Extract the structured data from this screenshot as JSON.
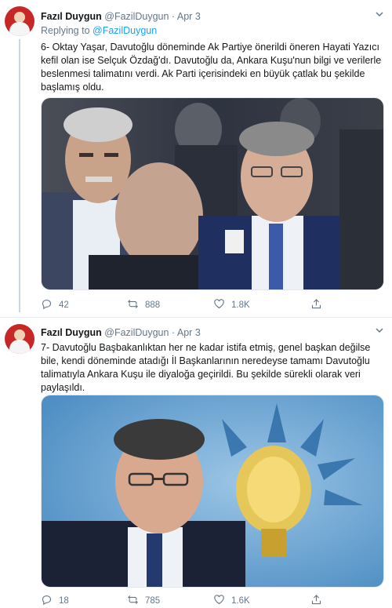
{
  "tweets": [
    {
      "author_name": "Fazıl Duygun",
      "handle": "@FazilDuygun",
      "date": "Apr 3",
      "separator": "·",
      "replying_prefix": "Replying to",
      "replying_to": "@FazilDuygun",
      "text": "6- Oktay Yaşar, Davutoğlu döneminde Ak Partiye önerildi öneren Hayati Yazıcı kefil olan ise Selçuk Özdağ'dı. Davutoğlu da, Ankara Kuşu'nun bilgi ve verilerle beslenmesi talimatını verdi. Ak Parti içerisindeki en büyük çatlak bu şekilde başlamış oldu.",
      "replies": "42",
      "retweets": "888",
      "likes": "1.8K"
    },
    {
      "author_name": "Fazıl Duygun",
      "handle": "@FazilDuygun",
      "date": "Apr 3",
      "separator": "·",
      "text": "7- Davutoğlu Başbakanlıktan her ne kadar istifa etmiş, genel başkan değilse bile, kendi döneminde atadığı İl Başkanlarının neredeyse tamamı Davutoğlu talimatıyla Ankara Kuşu ile diyaloğa geçirildi. Bu şekilde sürekli olarak veri paylaşıldı.",
      "replies": "18",
      "retweets": "785",
      "likes": "1.6K"
    }
  ],
  "icons": {
    "more": "chevron-down-icon",
    "reply": "reply-icon",
    "retweet": "retweet-icon",
    "like": "like-icon",
    "share": "share-icon"
  },
  "colors": {
    "accent": "#1da1f2",
    "secondary_text": "#657786",
    "primary_text": "#14171a"
  }
}
